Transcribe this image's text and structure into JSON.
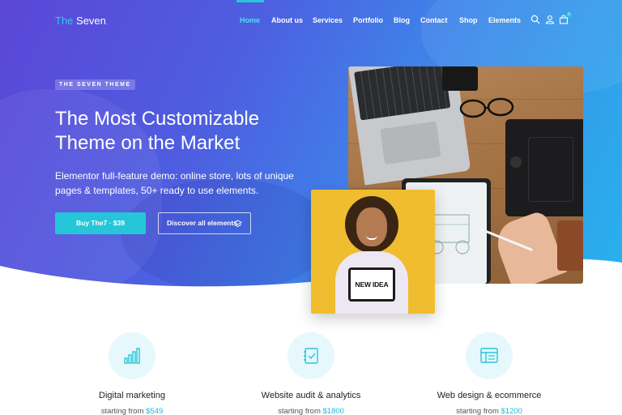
{
  "site": {
    "logo_prefix": "The",
    "logo_main": "Seven",
    "logo_dot": "."
  },
  "nav": {
    "items": [
      {
        "label": "Home",
        "active": true
      },
      {
        "label": "About us",
        "active": false
      },
      {
        "label": "Services",
        "active": false
      },
      {
        "label": "Portfolio",
        "active": false
      },
      {
        "label": "Blog",
        "active": false
      },
      {
        "label": "Contact",
        "active": false
      },
      {
        "label": "Shop",
        "active": false
      },
      {
        "label": "Elements",
        "active": false
      }
    ],
    "icons": [
      "search-icon",
      "user-icon",
      "shopping-bag-icon"
    ],
    "cart_count": "0"
  },
  "hero": {
    "eyebrow": "THE SEVEN THEME",
    "headline_line1": "The Most Customizable",
    "headline_line2": "Theme on the Market",
    "subtext_line1": "Elementor full-feature demo: online store, lots of unique",
    "subtext_line2": "pages & templates, 50+ ready to use elements.",
    "primary_button": "Buy The7 · $39",
    "secondary_button": "Discover all elements",
    "sign_text": "NEW IDEA"
  },
  "services": [
    {
      "title": "Digital marketing",
      "price_prefix": "starting from",
      "price": "$549",
      "icon": "bar-chart-icon"
    },
    {
      "title": "Website audit & analytics",
      "price_prefix": "starting from",
      "price": "$1800",
      "icon": "checklist-icon"
    },
    {
      "title": "Web design & ecommerce",
      "price_prefix": "starting from",
      "price": "$1200",
      "icon": "browser-window-icon"
    }
  ],
  "colors": {
    "accent": "#26c6da",
    "gradient_start": "#5b46d8",
    "gradient_end": "#27b3ec",
    "photo_yellow": "#efbd2f"
  }
}
